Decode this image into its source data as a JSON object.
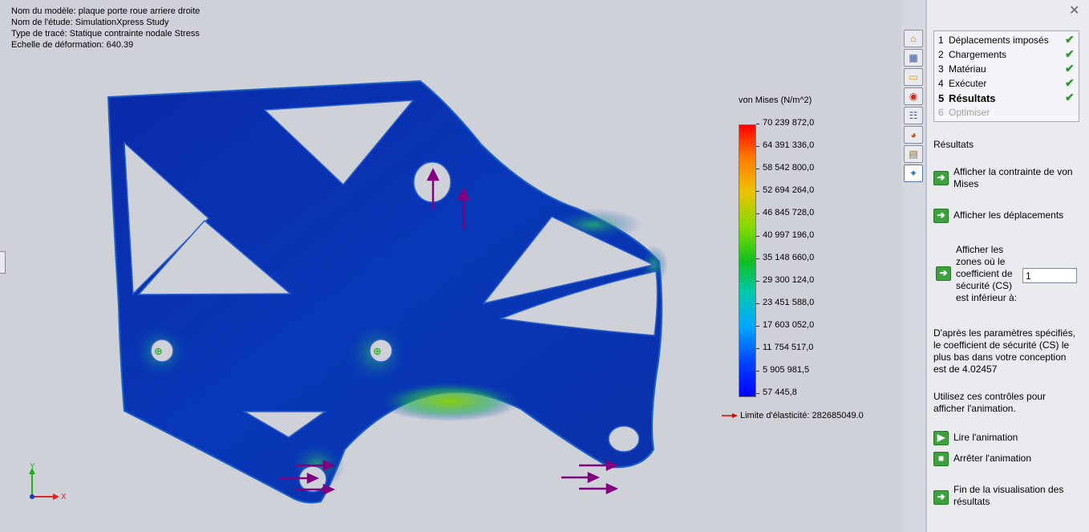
{
  "info": {
    "model_label": "Nom du modèle:",
    "model_value": "plaque porte roue arriere droite",
    "study_label": "Nom de l'étude:",
    "study_value": "SimulationXpress Study",
    "plot_label": "Type de tracé:",
    "plot_value": "Statique contrainte nodale Stress",
    "deform_label": "Echelle de déformation:",
    "deform_value": "640.39"
  },
  "legend": {
    "title": "von Mises (N/m^2)",
    "ticks": [
      "70 239 872,0",
      "64 391 336,0",
      "58 542 800,0",
      "52 694 264,0",
      "46 845 728,0",
      "40 997 196,0",
      "35 148 660,0",
      "29 300 124,0",
      "23 451 588,0",
      "17 603 052,0",
      "11 754 517,0",
      "5 905 981,5",
      "57 445,8"
    ],
    "yield": "Limite d'élasticité: 282685049.0"
  },
  "triad": {
    "x": "X",
    "y": "Y"
  },
  "tools": [
    "home-icon",
    "tree-icon",
    "folder-icon",
    "study-icon",
    "configuration-icon",
    "appearance-icon",
    "scene-icon",
    "simulation-icon"
  ],
  "steps": [
    {
      "num": "1",
      "label": "Déplacements imposés",
      "status": "done"
    },
    {
      "num": "2",
      "label": "Chargements",
      "status": "done"
    },
    {
      "num": "3",
      "label": "Matériau",
      "status": "done"
    },
    {
      "num": "4",
      "label": "Exécuter",
      "status": "done"
    },
    {
      "num": "5",
      "label": "Résultats",
      "status": "current"
    },
    {
      "num": "6",
      "label": "Optimiser",
      "status": "disabled"
    }
  ],
  "results": {
    "heading": "Résultats",
    "show_stress": "Afficher la contrainte de von Mises",
    "show_disp": "Afficher les déplacements",
    "show_fos": "Afficher les zones où le coefficient de sécurité (CS) est inférieur à:",
    "fos_value": "1",
    "conclusion": "D'après les paramètres spécifiés, le coefficient de sécurité (CS) le plus bas dans votre conception est de 4.02457",
    "anim_note": "Utilisez ces contrôles pour afficher l'animation.",
    "play": "Lire l'animation",
    "stop": "Arrêter l'animation",
    "finish": "Fin de la visualisation des résultats"
  },
  "close_glyph": "✕"
}
